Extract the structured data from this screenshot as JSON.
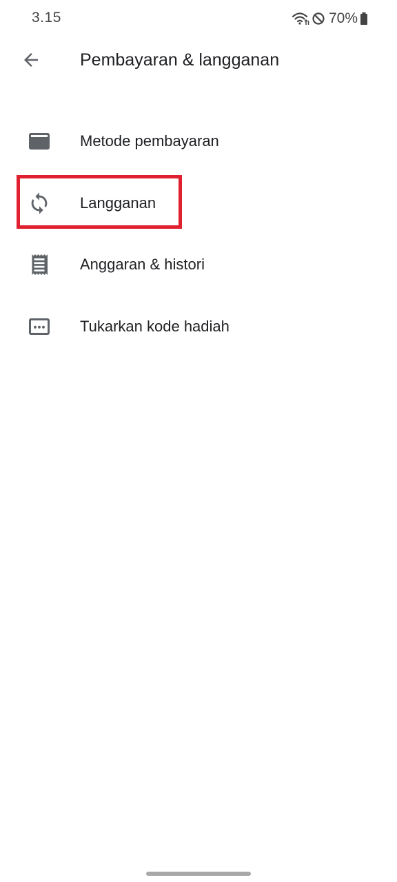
{
  "status_bar": {
    "time": "3.15",
    "battery_percent": "70%",
    "icons": [
      "wifi-icon",
      "do-not-disturb-icon",
      "battery-icon"
    ]
  },
  "app_bar": {
    "back_icon": "arrow-back-icon",
    "title": "Pembayaran & langganan"
  },
  "menu": {
    "items": [
      {
        "label": "Metode pembayaran",
        "icon": "credit-card-icon"
      },
      {
        "label": "Langganan",
        "icon": "sync-icon",
        "highlighted": true
      },
      {
        "label": "Anggaran & histori",
        "icon": "receipt-icon"
      },
      {
        "label": "Tukarkan kode hadiah",
        "icon": "gift-code-icon"
      }
    ]
  },
  "colors": {
    "highlight": "#e0202e",
    "icon": "#5f6368",
    "text": "#202124"
  }
}
